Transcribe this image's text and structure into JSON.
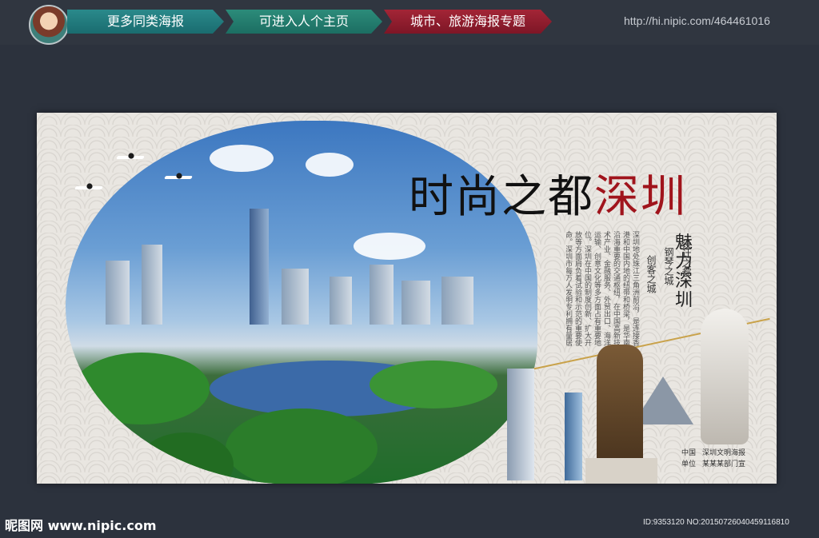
{
  "nav": {
    "tabs": [
      {
        "label": "更多同类海报"
      },
      {
        "label": "可进入人个主页"
      },
      {
        "label": "城市、旅游海报专题"
      }
    ],
    "url": "http://hi.nipic.com/464461016"
  },
  "poster": {
    "headline_black": "时尚之都",
    "headline_red": "深圳",
    "slogan": "魅力深圳",
    "subtitles": [
      "设计之都",
      "钢琴之城",
      "创客之城"
    ],
    "body": "深圳地处珠江三角洲前沿，是连接香港和中国内地的纽带和桥梁，是华南沿海重要的交通枢纽，在中国高新技术产业、金融服务、外贸出口、海洋运输、创意文化等多方面占有重要地位。深圳在中国的制度创新、扩大开放等方面肩负着试验和示范的重要使命。深圳市每万人发明专利拥有量居中国大城市首位；2011年，在全国大中城市中专利授权量为3月份中专利申请量为79.35件。",
    "credit": [
      {
        "label": "中国",
        "value": "深圳文明海报"
      },
      {
        "label": "单位",
        "value": "某某某部门宣"
      }
    ]
  },
  "footer": {
    "logo": "昵图网 www.nipic.com",
    "id": "ID:9353120 NO:20150726040459116810"
  },
  "colors": {
    "background": "#2c323d",
    "tab_teal": "#1f7a7c",
    "tab_red": "#8f1d2d",
    "headline_red": "#a0141c"
  }
}
